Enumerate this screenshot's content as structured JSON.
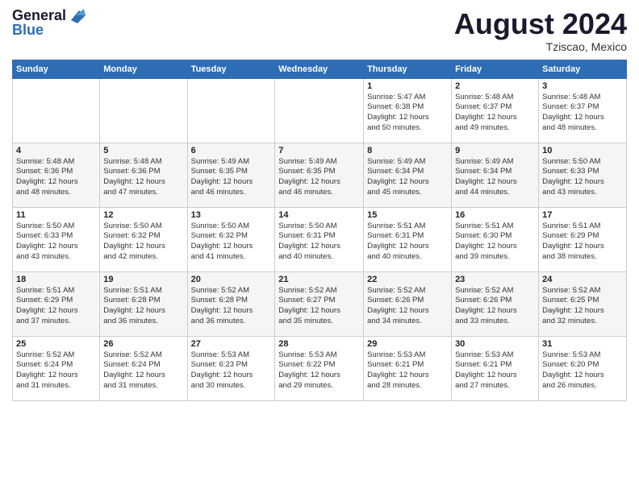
{
  "header": {
    "logo": "GeneralBlue",
    "title": "August 2024",
    "location": "Tziscao, Mexico"
  },
  "weekdays": [
    "Sunday",
    "Monday",
    "Tuesday",
    "Wednesday",
    "Thursday",
    "Friday",
    "Saturday"
  ],
  "weeks": [
    [
      {
        "day": "",
        "info": ""
      },
      {
        "day": "",
        "info": ""
      },
      {
        "day": "",
        "info": ""
      },
      {
        "day": "",
        "info": ""
      },
      {
        "day": "1",
        "info": "Sunrise: 5:47 AM\nSunset: 6:38 PM\nDaylight: 12 hours\nand 50 minutes."
      },
      {
        "day": "2",
        "info": "Sunrise: 5:48 AM\nSunset: 6:37 PM\nDaylight: 12 hours\nand 49 minutes."
      },
      {
        "day": "3",
        "info": "Sunrise: 5:48 AM\nSunset: 6:37 PM\nDaylight: 12 hours\nand 48 minutes."
      }
    ],
    [
      {
        "day": "4",
        "info": "Sunrise: 5:48 AM\nSunset: 6:36 PM\nDaylight: 12 hours\nand 48 minutes."
      },
      {
        "day": "5",
        "info": "Sunrise: 5:48 AM\nSunset: 6:36 PM\nDaylight: 12 hours\nand 47 minutes."
      },
      {
        "day": "6",
        "info": "Sunrise: 5:49 AM\nSunset: 6:35 PM\nDaylight: 12 hours\nand 46 minutes."
      },
      {
        "day": "7",
        "info": "Sunrise: 5:49 AM\nSunset: 6:35 PM\nDaylight: 12 hours\nand 46 minutes."
      },
      {
        "day": "8",
        "info": "Sunrise: 5:49 AM\nSunset: 6:34 PM\nDaylight: 12 hours\nand 45 minutes."
      },
      {
        "day": "9",
        "info": "Sunrise: 5:49 AM\nSunset: 6:34 PM\nDaylight: 12 hours\nand 44 minutes."
      },
      {
        "day": "10",
        "info": "Sunrise: 5:50 AM\nSunset: 6:33 PM\nDaylight: 12 hours\nand 43 minutes."
      }
    ],
    [
      {
        "day": "11",
        "info": "Sunrise: 5:50 AM\nSunset: 6:33 PM\nDaylight: 12 hours\nand 43 minutes."
      },
      {
        "day": "12",
        "info": "Sunrise: 5:50 AM\nSunset: 6:32 PM\nDaylight: 12 hours\nand 42 minutes."
      },
      {
        "day": "13",
        "info": "Sunrise: 5:50 AM\nSunset: 6:32 PM\nDaylight: 12 hours\nand 41 minutes."
      },
      {
        "day": "14",
        "info": "Sunrise: 5:50 AM\nSunset: 6:31 PM\nDaylight: 12 hours\nand 40 minutes."
      },
      {
        "day": "15",
        "info": "Sunrise: 5:51 AM\nSunset: 6:31 PM\nDaylight: 12 hours\nand 40 minutes."
      },
      {
        "day": "16",
        "info": "Sunrise: 5:51 AM\nSunset: 6:30 PM\nDaylight: 12 hours\nand 39 minutes."
      },
      {
        "day": "17",
        "info": "Sunrise: 5:51 AM\nSunset: 6:29 PM\nDaylight: 12 hours\nand 38 minutes."
      }
    ],
    [
      {
        "day": "18",
        "info": "Sunrise: 5:51 AM\nSunset: 6:29 PM\nDaylight: 12 hours\nand 37 minutes."
      },
      {
        "day": "19",
        "info": "Sunrise: 5:51 AM\nSunset: 6:28 PM\nDaylight: 12 hours\nand 36 minutes."
      },
      {
        "day": "20",
        "info": "Sunrise: 5:52 AM\nSunset: 6:28 PM\nDaylight: 12 hours\nand 36 minutes."
      },
      {
        "day": "21",
        "info": "Sunrise: 5:52 AM\nSunset: 6:27 PM\nDaylight: 12 hours\nand 35 minutes."
      },
      {
        "day": "22",
        "info": "Sunrise: 5:52 AM\nSunset: 6:26 PM\nDaylight: 12 hours\nand 34 minutes."
      },
      {
        "day": "23",
        "info": "Sunrise: 5:52 AM\nSunset: 6:26 PM\nDaylight: 12 hours\nand 33 minutes."
      },
      {
        "day": "24",
        "info": "Sunrise: 5:52 AM\nSunset: 6:25 PM\nDaylight: 12 hours\nand 32 minutes."
      }
    ],
    [
      {
        "day": "25",
        "info": "Sunrise: 5:52 AM\nSunset: 6:24 PM\nDaylight: 12 hours\nand 31 minutes."
      },
      {
        "day": "26",
        "info": "Sunrise: 5:52 AM\nSunset: 6:24 PM\nDaylight: 12 hours\nand 31 minutes."
      },
      {
        "day": "27",
        "info": "Sunrise: 5:53 AM\nSunset: 6:23 PM\nDaylight: 12 hours\nand 30 minutes."
      },
      {
        "day": "28",
        "info": "Sunrise: 5:53 AM\nSunset: 6:22 PM\nDaylight: 12 hours\nand 29 minutes."
      },
      {
        "day": "29",
        "info": "Sunrise: 5:53 AM\nSunset: 6:21 PM\nDaylight: 12 hours\nand 28 minutes."
      },
      {
        "day": "30",
        "info": "Sunrise: 5:53 AM\nSunset: 6:21 PM\nDaylight: 12 hours\nand 27 minutes."
      },
      {
        "day": "31",
        "info": "Sunrise: 5:53 AM\nSunset: 6:20 PM\nDaylight: 12 hours\nand 26 minutes."
      }
    ]
  ]
}
